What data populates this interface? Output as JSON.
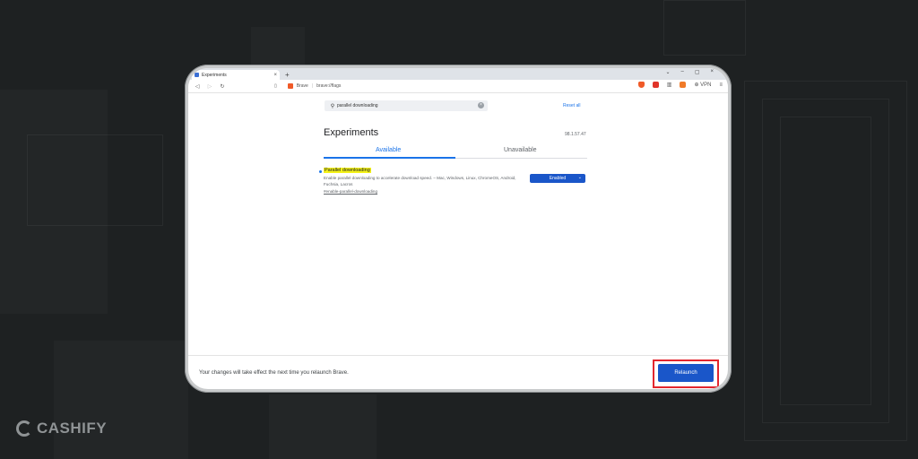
{
  "browser": {
    "tab_title": "Experiments",
    "tab_close": "×",
    "new_tab": "+",
    "window_controls": [
      "⌄",
      "–",
      "▢",
      "×"
    ],
    "url_brand": "Brave",
    "url_sep": "|",
    "url_path": "brave://flags",
    "vpn_label": "VPN"
  },
  "page": {
    "search_value": "parallel downloading",
    "reset_all": "Reset all",
    "title": "Experiments",
    "version": "98.1.57.47",
    "tab_available": "Available",
    "tab_unavailable": "Unavailable"
  },
  "flag": {
    "name": "Parallel downloading",
    "description": "Enable parallel downloading to accelerate download speed. – Mac, Windows, Linux, ChromeOS, Android, Fuchsia, Lacros",
    "link": "#enable-parallel-downloading",
    "state": "Enabled"
  },
  "footer": {
    "message": "Your changes will take effect the next time you relaunch Brave.",
    "relaunch": "Relaunch"
  },
  "logo": {
    "text": "CASHIFY"
  },
  "colors": {
    "accent": "#1a73e8",
    "button": "#1a56c9",
    "highlight": "#f4f21a",
    "callout": "#e3262e"
  }
}
